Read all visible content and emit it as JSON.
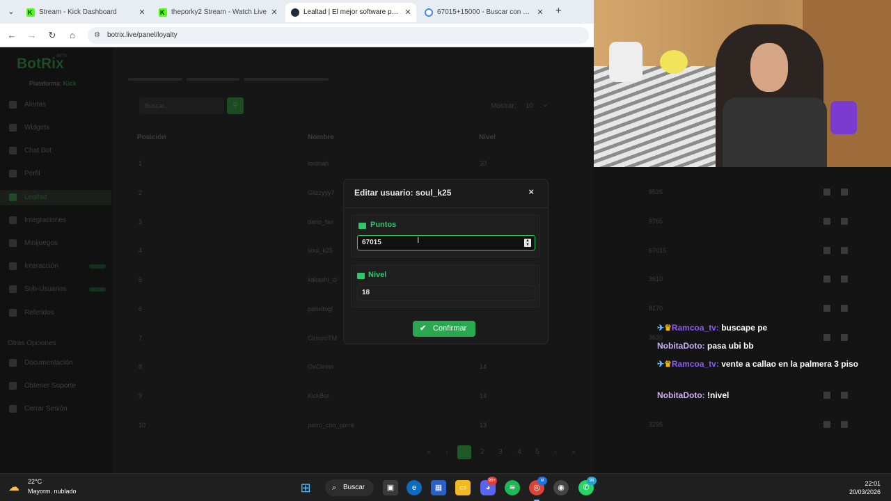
{
  "browser": {
    "tabs": [
      {
        "title": "Stream - Kick Dashboard"
      },
      {
        "title": "theporky2 Stream - Watch Live"
      },
      {
        "title": "Lealtad | El mejor software para"
      },
      {
        "title": "67015+15000 - Buscar con Goo"
      }
    ],
    "url": "botrix.live/panel/loyalty"
  },
  "sidebar": {
    "logo": "BotRix",
    "beta": "BETA",
    "platform_label": "Plataforma:",
    "platform_value": "Kick",
    "items": [
      {
        "label": "Alertas"
      },
      {
        "label": "Widgets"
      },
      {
        "label": "Chat Bot"
      },
      {
        "label": "Perfil"
      },
      {
        "label": "Lealtad"
      },
      {
        "label": "Integraciones"
      },
      {
        "label": "Minijuegos"
      },
      {
        "label": "Interacción"
      },
      {
        "label": "Sub-Usuarios"
      },
      {
        "label": "Referidos"
      }
    ],
    "section": "Otras Opciones",
    "other_items": [
      {
        "label": "Documentación"
      },
      {
        "label": "Obtener Soporte"
      },
      {
        "label": "Cerrar Sesión"
      }
    ]
  },
  "table": {
    "search_placeholder": "Buscar...",
    "show_label": "Mostrar:",
    "show_value": "10",
    "headers": [
      "Posición",
      "Nombre",
      "Nivel"
    ],
    "rows": [
      {
        "pos": "1",
        "name": "lordoah",
        "level": "30",
        "points": ""
      },
      {
        "pos": "2",
        "name": "Glizzyyy7",
        "level": "",
        "points": "9525"
      },
      {
        "pos": "3",
        "name": "dario_fax",
        "level": "",
        "points": "9765"
      },
      {
        "pos": "4",
        "name": "soul_k25",
        "level": "",
        "points": "67015"
      },
      {
        "pos": "5",
        "name": "kakashi_cl",
        "level": "",
        "points": "3610"
      },
      {
        "pos": "6",
        "name": "panxitogl",
        "level": "",
        "points": "8170"
      },
      {
        "pos": "7",
        "name": "ClcruroTM",
        "level": "",
        "points": "3630"
      },
      {
        "pos": "8",
        "name": "OxClinnn",
        "level": "14",
        "points": ""
      },
      {
        "pos": "9",
        "name": "KickBot",
        "level": "14",
        "points": ""
      },
      {
        "pos": "10",
        "name": "perro_con_gorra",
        "level": "13",
        "points": "3295"
      }
    ],
    "pages": [
      "«",
      "‹",
      "1",
      "2",
      "3",
      "4",
      "5",
      "›",
      "»"
    ]
  },
  "modal": {
    "title": "Editar usuario: soul_k25",
    "close": "×",
    "points_label": "Puntos",
    "points_value": "67015",
    "level_label": "Nivel",
    "level_value": "18",
    "confirm_label": "Confirmar"
  },
  "chat": [
    {
      "user": "Ramcoa_tv:",
      "text": "buscape pe"
    },
    {
      "user": "NobitaDoto:",
      "text": "pasa ubi bb"
    },
    {
      "user": "Ramcoa_tv:",
      "text": "vente a callao en la palmera 3 piso"
    },
    {
      "user": "NobitaDoto:",
      "text": "!nivel"
    }
  ],
  "taskbar": {
    "temp": "22°C",
    "weather": "Mayorm. nublado",
    "search_label": "Buscar",
    "discord_badge": "99+",
    "chrome_badge": "M",
    "whatsapp_badge": "96",
    "time": "22:01",
    "date": "20/03/2026"
  },
  "colors": {
    "accent": "#2ec866",
    "confirm": "#2aa84f",
    "chat_user": "#8b5cf6"
  }
}
